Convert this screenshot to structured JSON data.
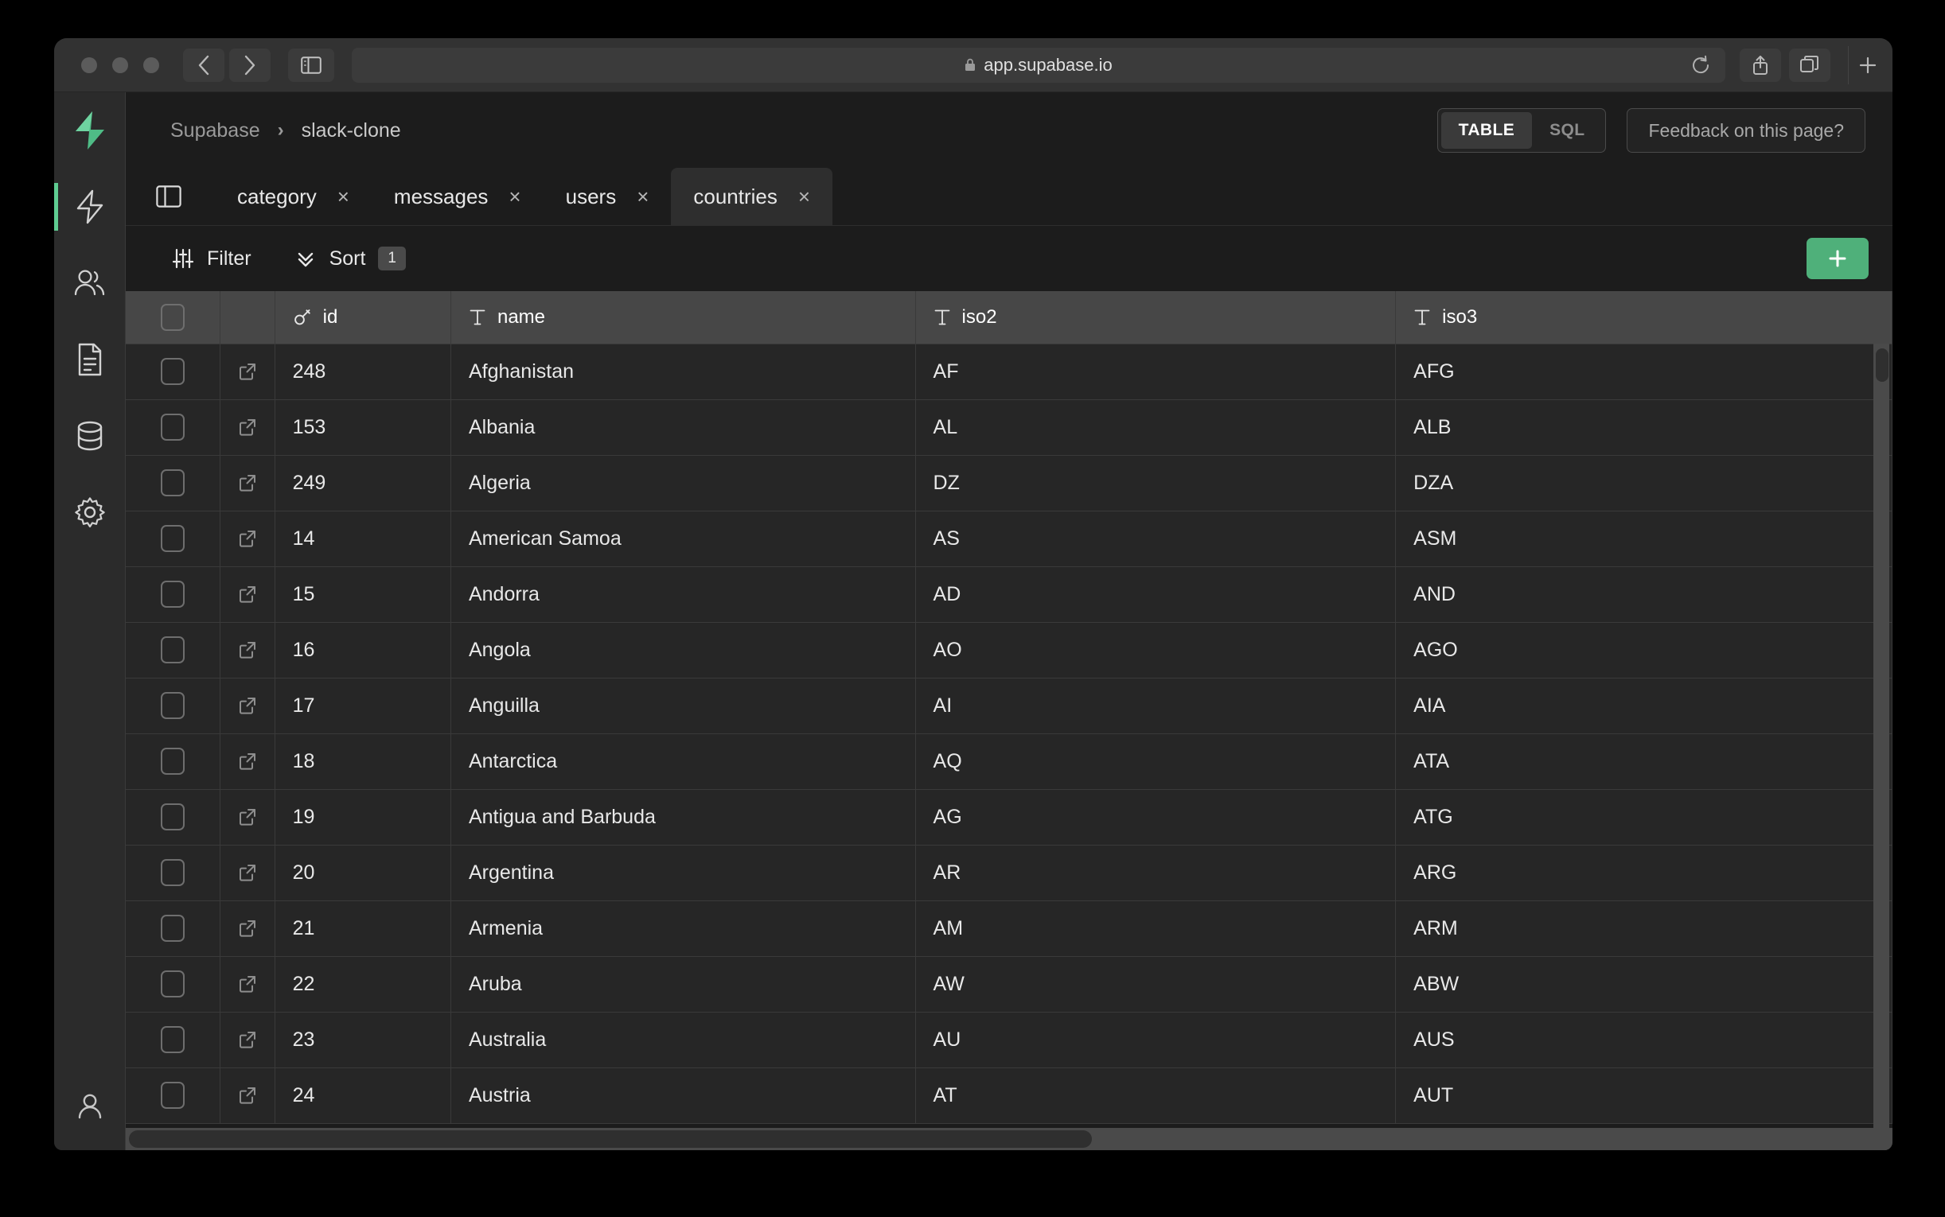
{
  "browser": {
    "url": "app.supabase.io",
    "lock_icon": "lock-icon",
    "back_icon": "chevron-left-icon",
    "forward_icon": "chevron-right-icon",
    "sidebar_icon": "sidebar-panel-icon",
    "reload_icon": "reload-icon",
    "share_icon": "share-icon",
    "tabs_icon": "tab-overview-icon",
    "newtab_icon": "plus-icon"
  },
  "rail": {
    "logo_icon": "supabase-logo-icon",
    "items": [
      {
        "icon": "bolt-icon",
        "name": "home",
        "active": true
      },
      {
        "icon": "users-icon",
        "name": "auth",
        "active": false
      },
      {
        "icon": "document-icon",
        "name": "docs",
        "active": false
      },
      {
        "icon": "database-icon",
        "name": "database",
        "active": false
      },
      {
        "icon": "gear-icon",
        "name": "settings",
        "active": false
      }
    ],
    "account_icon": "user-icon"
  },
  "header": {
    "breadcrumb": {
      "org": "Supabase",
      "separator": "›",
      "project": "slack-clone"
    },
    "view_toggle": {
      "options": [
        "TABLE",
        "SQL"
      ],
      "selected": "TABLE"
    },
    "feedback_label": "Feedback on this page?"
  },
  "tabs": {
    "panel_toggle_icon": "sidebar-panel-icon",
    "close_icon": "×",
    "items": [
      {
        "label": "category",
        "active": false
      },
      {
        "label": "messages",
        "active": false
      },
      {
        "label": "users",
        "active": false
      },
      {
        "label": "countries",
        "active": true
      }
    ]
  },
  "toolbar": {
    "filter_label": "Filter",
    "filter_icon": "sliders-icon",
    "sort_label": "Sort",
    "sort_icon": "chevrons-down-icon",
    "sort_count": "1",
    "add_icon": "plus-icon",
    "add_label": "+"
  },
  "grid": {
    "columns": [
      {
        "key": "id",
        "label": "id",
        "type_icon": "key-icon"
      },
      {
        "key": "name",
        "label": "name",
        "type_icon": "text-type-icon"
      },
      {
        "key": "iso2",
        "label": "iso2",
        "type_icon": "text-type-icon"
      },
      {
        "key": "iso3",
        "label": "iso3",
        "type_icon": "text-type-icon"
      }
    ],
    "row_expand_icon": "external-link-icon",
    "select_all_icon": "checkbox-icon",
    "rows": [
      {
        "id": "248",
        "name": "Afghanistan",
        "iso2": "AF",
        "iso3": "AFG"
      },
      {
        "id": "153",
        "name": "Albania",
        "iso2": "AL",
        "iso3": "ALB"
      },
      {
        "id": "249",
        "name": "Algeria",
        "iso2": "DZ",
        "iso3": "DZA"
      },
      {
        "id": "14",
        "name": "American Samoa",
        "iso2": "AS",
        "iso3": "ASM"
      },
      {
        "id": "15",
        "name": "Andorra",
        "iso2": "AD",
        "iso3": "AND"
      },
      {
        "id": "16",
        "name": "Angola",
        "iso2": "AO",
        "iso3": "AGO"
      },
      {
        "id": "17",
        "name": "Anguilla",
        "iso2": "AI",
        "iso3": "AIA"
      },
      {
        "id": "18",
        "name": "Antarctica",
        "iso2": "AQ",
        "iso3": "ATA"
      },
      {
        "id": "19",
        "name": "Antigua and Barbuda",
        "iso2": "AG",
        "iso3": "ATG"
      },
      {
        "id": "20",
        "name": "Argentina",
        "iso2": "AR",
        "iso3": "ARG"
      },
      {
        "id": "21",
        "name": "Armenia",
        "iso2": "AM",
        "iso3": "ARM"
      },
      {
        "id": "22",
        "name": "Aruba",
        "iso2": "AW",
        "iso3": "ABW"
      },
      {
        "id": "23",
        "name": "Australia",
        "iso2": "AU",
        "iso3": "AUS"
      },
      {
        "id": "24",
        "name": "Austria",
        "iso2": "AT",
        "iso3": "AUT"
      }
    ]
  },
  "colors": {
    "accent_green": "#4fb07a",
    "logo_green": "#58c58e",
    "chrome_bg": "#323232",
    "app_bg": "#1c1c1c",
    "row_bg": "#262626",
    "header_row_bg": "#474747"
  }
}
